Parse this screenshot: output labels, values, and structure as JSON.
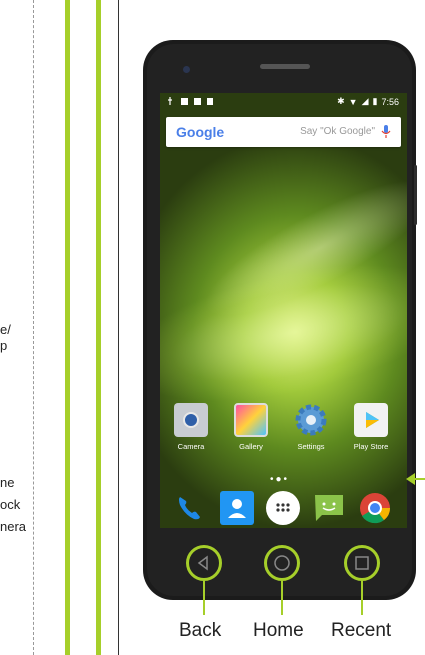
{
  "side_labels": {
    "label_a": "e/\np",
    "label_b": "ne\nock\nnera"
  },
  "status_bar": {
    "time": "7:56"
  },
  "search": {
    "logo": "Google",
    "hint": "Say \"Ok Google\""
  },
  "apps": [
    {
      "label": "Camera",
      "icon": "camera-icon"
    },
    {
      "label": "Gallery",
      "icon": "gallery-icon"
    },
    {
      "label": "Settings",
      "icon": "settings-gear-icon"
    },
    {
      "label": "Play Store",
      "icon": "play-store-icon"
    }
  ],
  "dock": [
    {
      "icon": "phone-icon"
    },
    {
      "icon": "contacts-icon"
    },
    {
      "icon": "app-drawer-icon"
    },
    {
      "icon": "messaging-icon"
    },
    {
      "icon": "chrome-icon"
    }
  ],
  "nav_buttons": {
    "back": "Back",
    "home": "Home",
    "recent": "Recent"
  },
  "colors": {
    "accent": "#a6cf2a",
    "phone_body": "#1b1b1b"
  }
}
